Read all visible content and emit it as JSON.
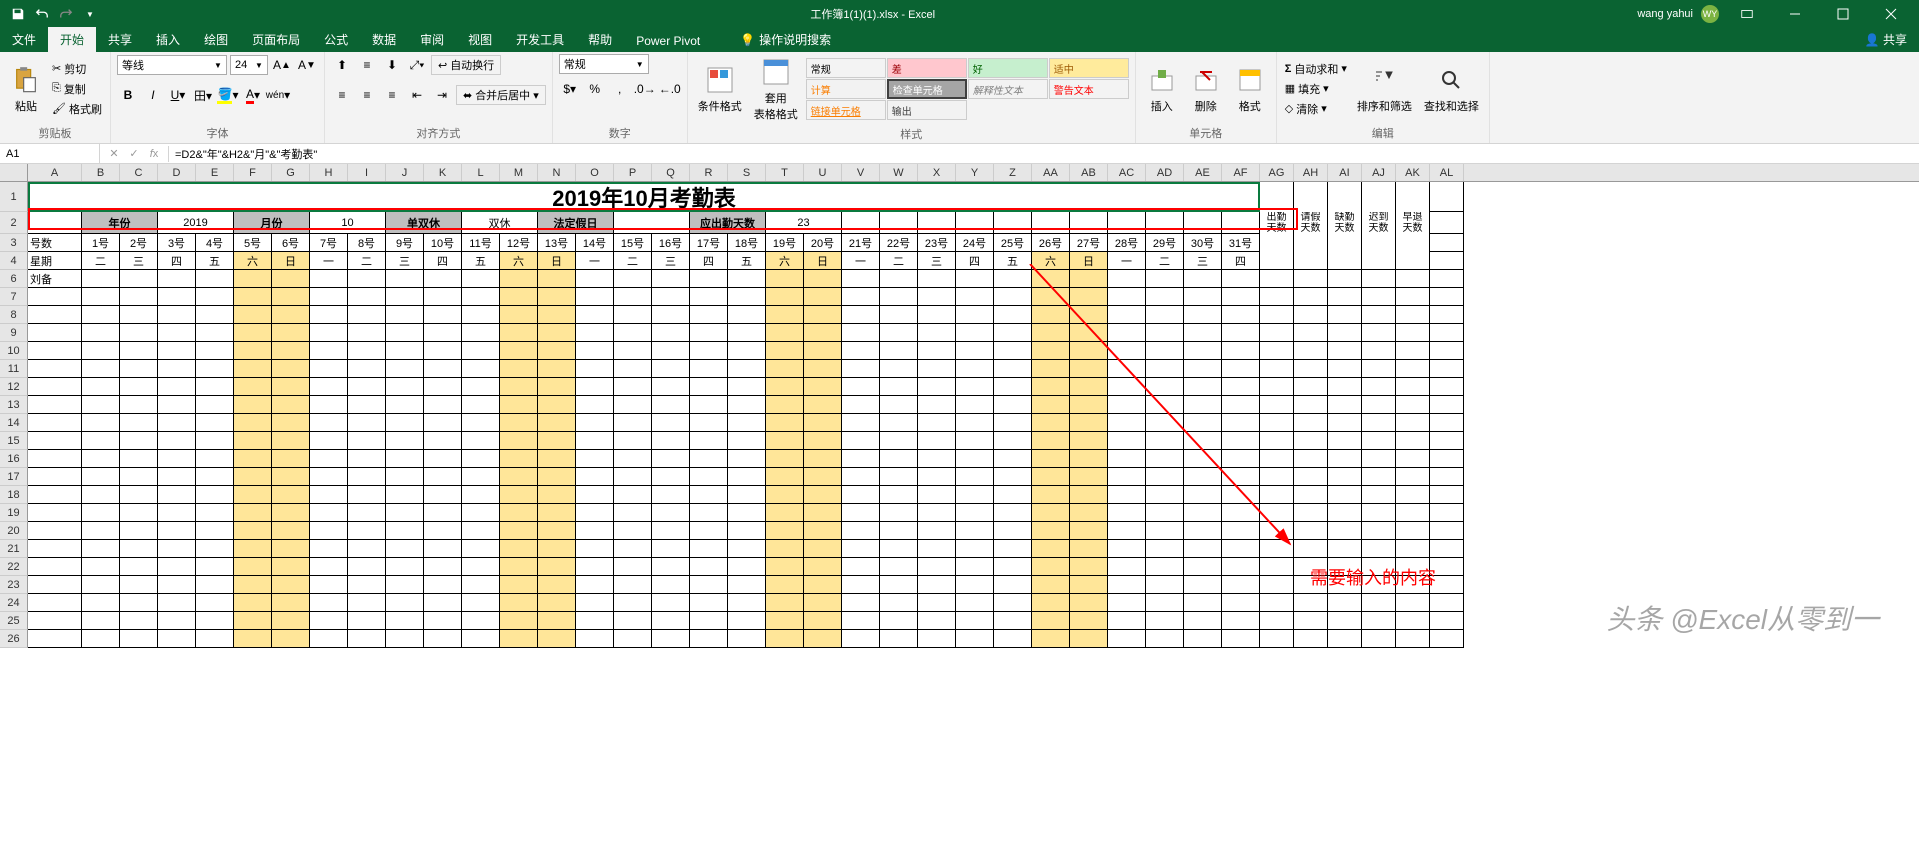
{
  "titlebar": {
    "doc_title": "工作簿1(1)(1).xlsx - Excel",
    "user": "wang yahui",
    "avatar": "WY"
  },
  "tabs": {
    "file": "文件",
    "home": "开始",
    "share_tab": "共享",
    "insert": "插入",
    "draw": "绘图",
    "layout": "页面布局",
    "formulas": "公式",
    "data": "数据",
    "review": "审阅",
    "view": "视图",
    "dev": "开发工具",
    "help": "帮助",
    "powerpivot": "Power Pivot",
    "tellme": "操作说明搜索",
    "share_btn": "共享"
  },
  "ribbon": {
    "clipboard": {
      "paste": "粘贴",
      "cut": "剪切",
      "copy": "复制",
      "painter": "格式刷",
      "label": "剪贴板"
    },
    "font": {
      "name": "等线",
      "size": "24",
      "label": "字体"
    },
    "align": {
      "wrap": "自动换行",
      "merge": "合并后居中",
      "label": "对齐方式"
    },
    "number": {
      "format": "常规",
      "label": "数字"
    },
    "styles": {
      "cond": "条件格式",
      "table": "套用\n表格格式",
      "s1": "常规",
      "s2": "差",
      "s3": "好",
      "s4": "适中",
      "s5": "计算",
      "s6": "检查单元格",
      "s7": "解释性文本",
      "s8": "警告文本",
      "s9": "链接单元格",
      "s10": "输出",
      "label": "样式"
    },
    "cells": {
      "insert": "插入",
      "delete": "删除",
      "format": "格式",
      "label": "单元格"
    },
    "editing": {
      "sum": "自动求和",
      "fill": "填充",
      "clear": "清除",
      "sort": "排序和筛选",
      "find": "查找和选择",
      "label": "编辑"
    }
  },
  "namebox": "A1",
  "formula": "=D2&\"年\"&H2&\"月\"&\"考勤表\"",
  "columns": [
    "A",
    "B",
    "C",
    "D",
    "E",
    "F",
    "G",
    "H",
    "I",
    "J",
    "K",
    "L",
    "M",
    "N",
    "O",
    "P",
    "Q",
    "R",
    "S",
    "T",
    "U",
    "V",
    "W",
    "X",
    "Y",
    "Z",
    "AA",
    "AB",
    "AC",
    "AD",
    "AE",
    "AF",
    "AG",
    "AH",
    "AI",
    "AJ",
    "AK",
    "AL"
  ],
  "row_nums": [
    1,
    2,
    3,
    4,
    6,
    7,
    8,
    9,
    10,
    11,
    12,
    13,
    14,
    15,
    16,
    17,
    18,
    19,
    20,
    21,
    22,
    23,
    24,
    25,
    26
  ],
  "sheet": {
    "title": "2019年10月考勤表",
    "r2": {
      "year_lbl": "年份",
      "year_val": "2019",
      "month_lbl": "月份",
      "month_val": "10",
      "rest_lbl": "单双休",
      "rest_val": "双休",
      "holiday_lbl": "法定假日",
      "attend_lbl": "应出勤天数",
      "attend_val": "23"
    },
    "r3_label": "号数",
    "days": [
      "1号",
      "2号",
      "3号",
      "4号",
      "5号",
      "6号",
      "7号",
      "8号",
      "9号",
      "10号",
      "11号",
      "12号",
      "13号",
      "14号",
      "15号",
      "16号",
      "17号",
      "18号",
      "19号",
      "20号",
      "21号",
      "22号",
      "23号",
      "24号",
      "25号",
      "26号",
      "27号",
      "28号",
      "29号",
      "30号",
      "31号"
    ],
    "r4_label": "星期",
    "weekdays": [
      "二",
      "三",
      "四",
      "五",
      "六",
      "日",
      "一",
      "二",
      "三",
      "四",
      "五",
      "六",
      "日",
      "一",
      "二",
      "三",
      "四",
      "五",
      "六",
      "日",
      "一",
      "二",
      "三",
      "四",
      "五",
      "六",
      "日",
      "一",
      "二",
      "三",
      "四"
    ],
    "summary_cols": [
      "出勤\n天数",
      "请假\n天数",
      "缺勤\n天数",
      "迟到\n天数",
      "早退\n天数"
    ],
    "name1": "刘备"
  },
  "weekend_idx": [
    4,
    5,
    11,
    12,
    18,
    19,
    25,
    26
  ],
  "annotation": "需要输入的内容",
  "watermark": "头条 @Excel从零到一"
}
